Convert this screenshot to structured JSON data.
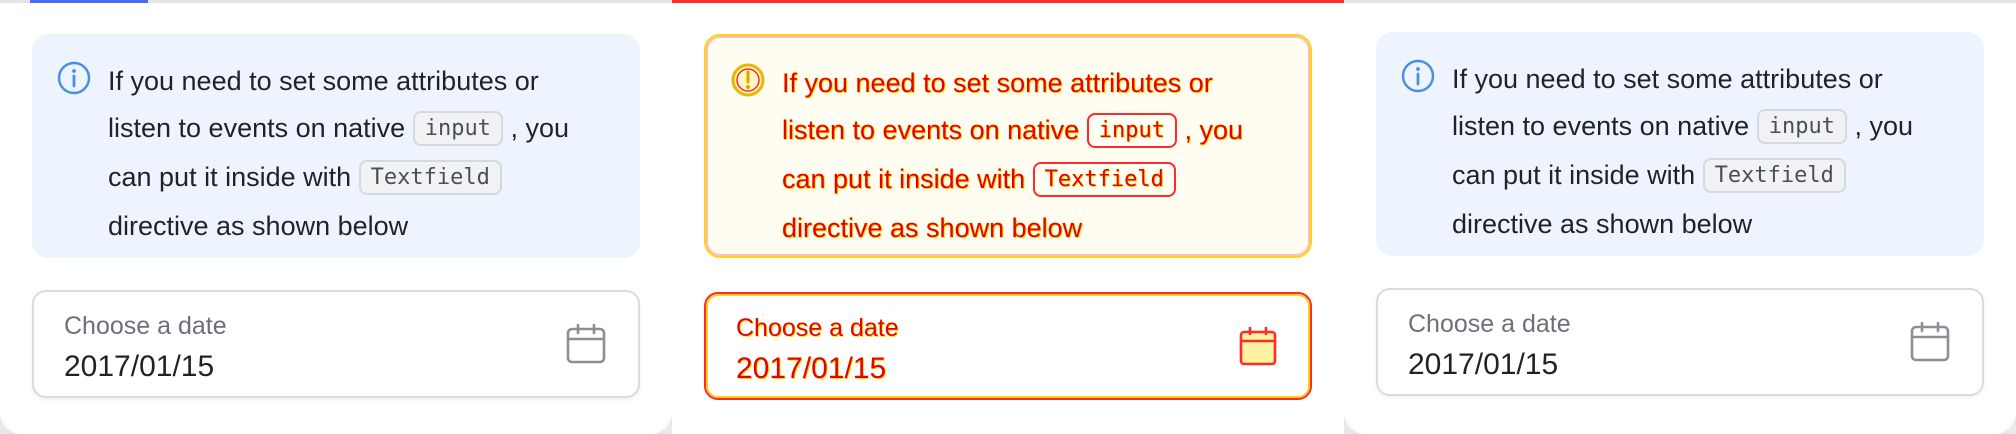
{
  "panels": [
    {
      "info": {
        "line1": "If you need to set some attributes or",
        "line2_pre": "listen to events on native",
        "code1": "input",
        "line2_post": ", you",
        "line3_pre": "can put it inside with",
        "code2": "Textfield",
        "line4": "directive as shown below"
      },
      "field": {
        "label": "Choose a date",
        "value": "2017/01/15"
      }
    },
    {
      "info": {
        "line1": "If you need to set some attributes or",
        "line2_pre": "listen to events on native",
        "code1": "input",
        "line2_post": ", you",
        "line3_pre": "can put it inside with",
        "code2": "Textfield",
        "line4": "directive as shown below"
      },
      "field": {
        "label": "Choose a date",
        "value": "2017/01/15"
      }
    },
    {
      "info": {
        "line1": "If you need to set some attributes or",
        "line2_pre": "listen to events on native",
        "code1": "input",
        "line2_post": ", you",
        "line3_pre": "can put it inside with",
        "code2": "Textfield",
        "line4": "directive as shown below"
      },
      "field": {
        "label": "Choose a date",
        "value": "2017/01/15"
      }
    }
  ],
  "icons": {
    "info": "info-circle-icon",
    "calendar": "calendar-icon"
  },
  "colors": {
    "info_bg": "#edf4fd",
    "info_icon": "#4a90e2",
    "diff_red": "#ff2a2a",
    "diff_yellow": "#ffd21a"
  }
}
